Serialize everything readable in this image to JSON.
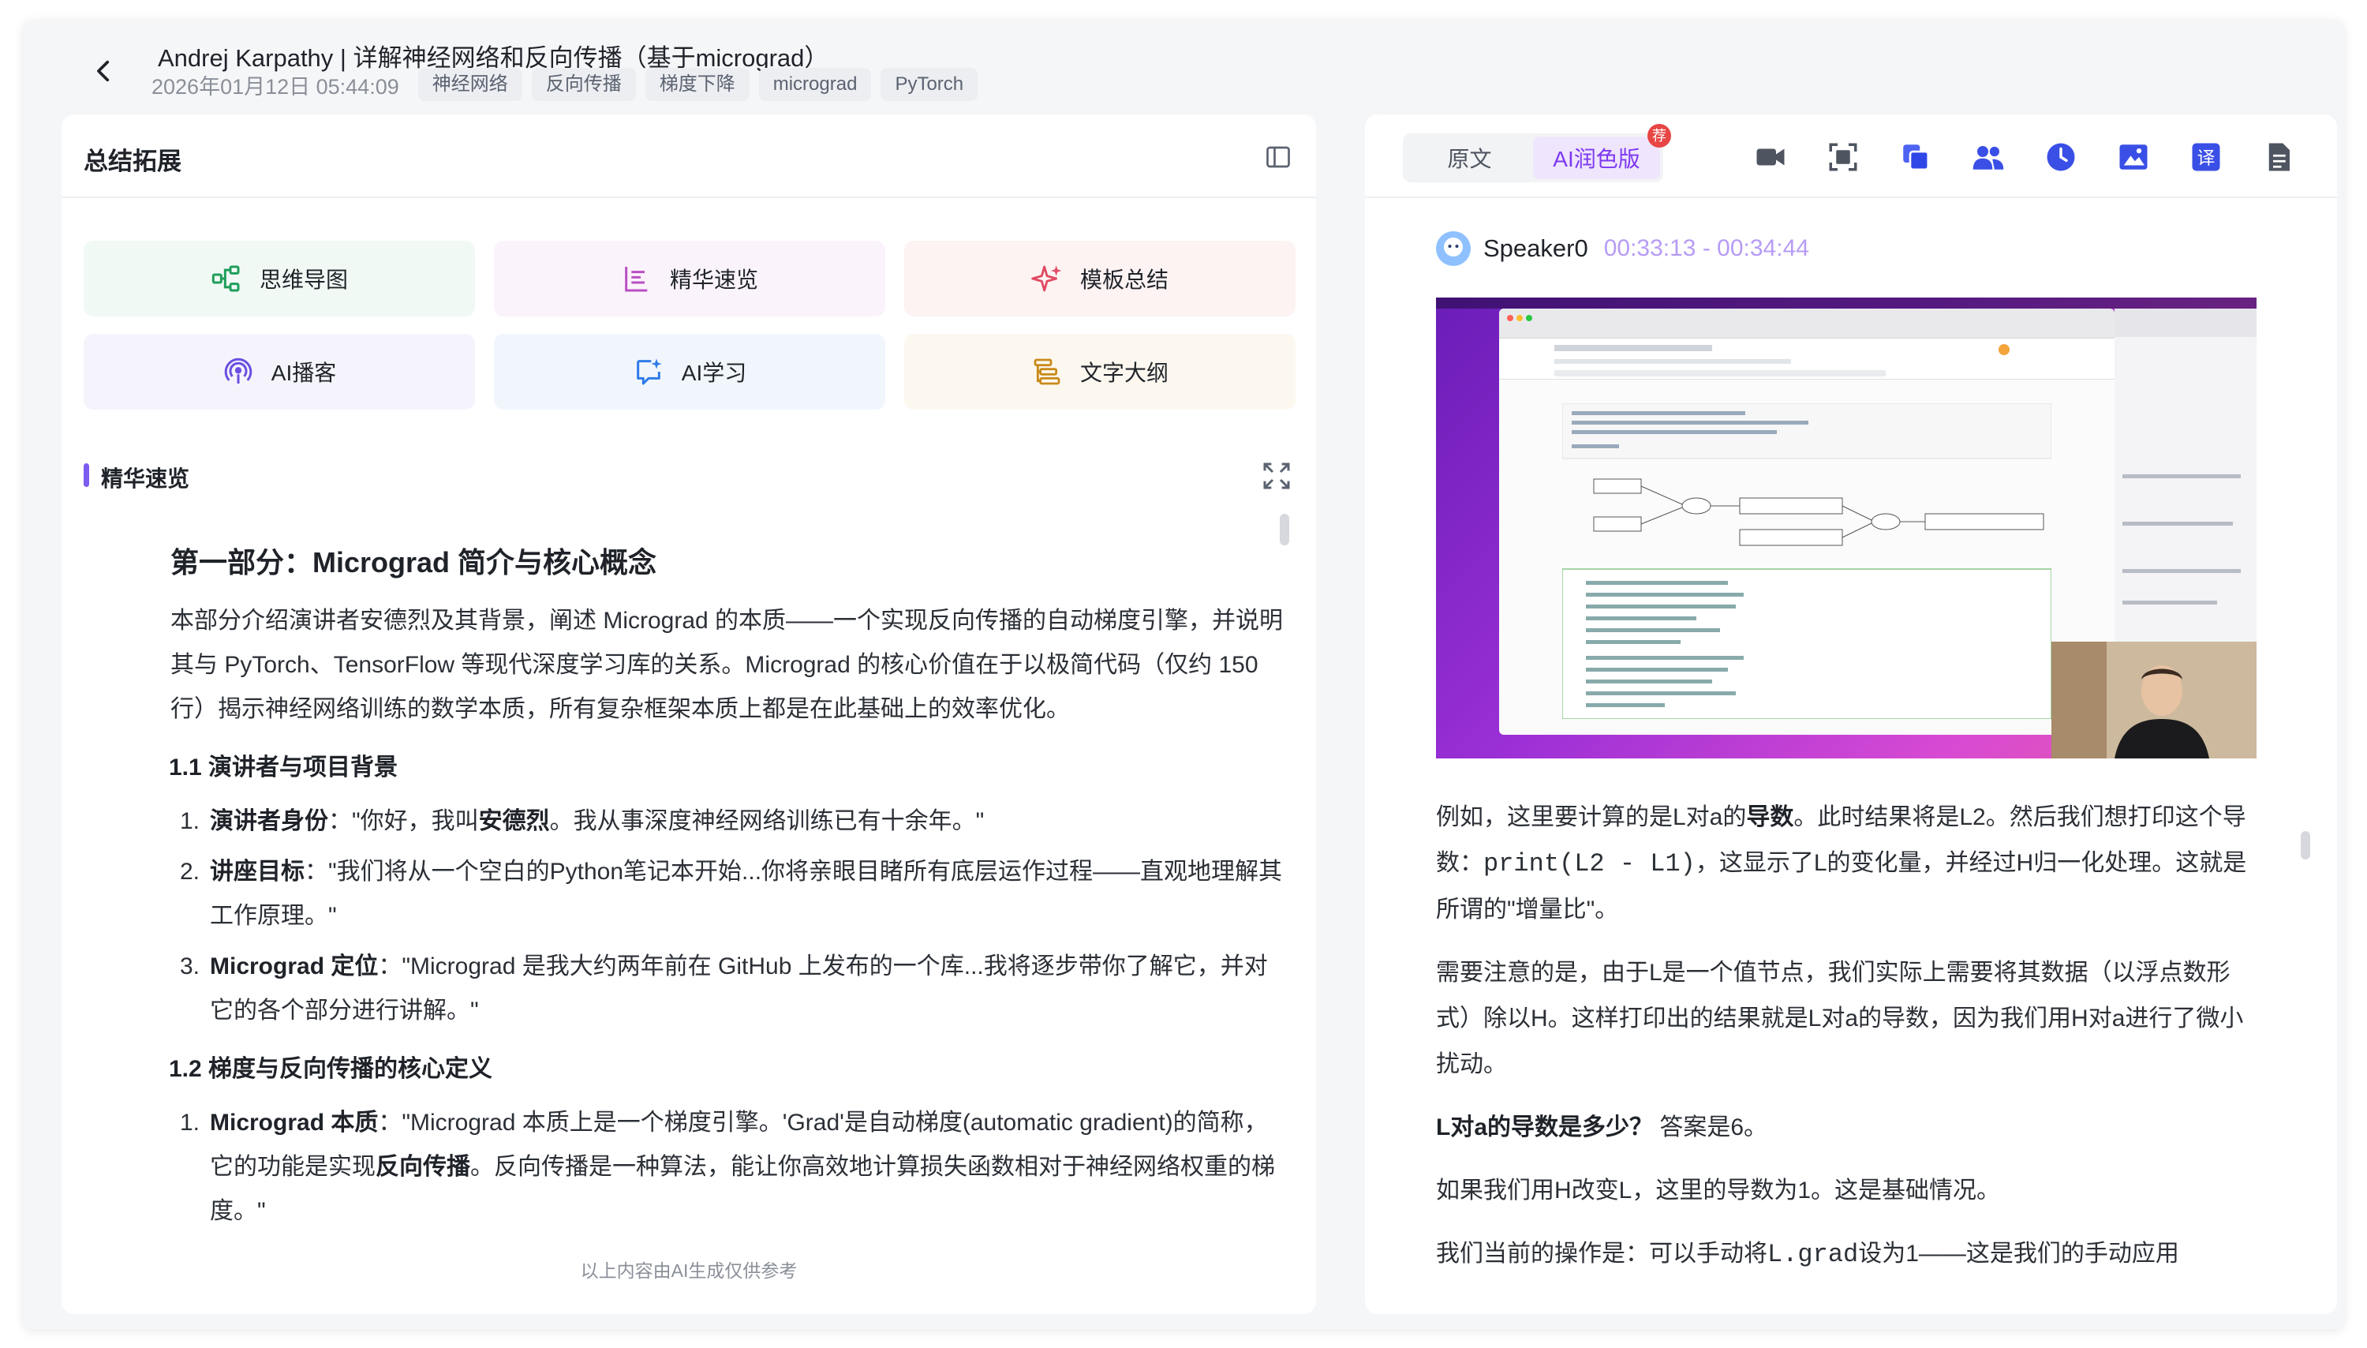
{
  "header": {
    "title": "Andrej Karpathy | 详解神经网络和反向传播（基于micrograd）",
    "date": "2026年01月12日 05:44:09",
    "tags": [
      "神经网络",
      "反向传播",
      "梯度下降",
      "micrograd",
      "PyTorch"
    ]
  },
  "left_panel": {
    "title": "总结拓展",
    "tools": [
      {
        "label": "思维导图",
        "icon": "mindmap-icon",
        "color": "#1e9e5a"
      },
      {
        "label": "精华速览",
        "icon": "list-icon",
        "color": "#b84fc4"
      },
      {
        "label": "模板总结",
        "icon": "sparkle-icon",
        "color": "#e04a62"
      },
      {
        "label": "AI播客",
        "icon": "podcast-icon",
        "color": "#6b4fe0"
      },
      {
        "label": "AI学习",
        "icon": "ai-learn-icon",
        "color": "#2f7be8"
      },
      {
        "label": "文字大纲",
        "icon": "outline-icon",
        "color": "#c98a1c"
      }
    ],
    "section_label": "精华速览",
    "article": {
      "heading": "第一部分：Micrograd 简介与核心概念",
      "intro": "本部分介绍演讲者安德烈及其背景，阐述 Micrograd 的本质——一个实现反向传播的自动梯度引擎，并说明其与 PyTorch、TensorFlow 等现代深度学习库的关系。Micrograd 的核心价值在于以极简代码（仅约 150 行）揭示神经网络训练的数学本质，所有复杂框架本质上都是在此基础上的效率优化。",
      "sub1": "1.1 演讲者与项目背景",
      "list1": [
        {
          "num": "1.",
          "bold": "演讲者身份",
          "pre": "：\"你好，我叫",
          "bold2": "安德烈",
          "post": "。我从事深度神经网络训练已有十余年。\""
        },
        {
          "num": "2.",
          "bold": "讲座目标",
          "pre": "：\"我们将从一个空白的Python笔记本开始...你将亲眼目睹所有底层运作过程——直观地理解其工作原理。\"",
          "bold2": "",
          "post": ""
        },
        {
          "num": "3.",
          "bold": "Micrograd 定位",
          "pre": "：\"Micrograd 是我大约两年前在 GitHub 上发布的一个库...我将逐步带你了解它，并对它的各个部分进行讲解。\"",
          "bold2": "",
          "post": ""
        }
      ],
      "sub2": "1.2 梯度与反向传播的核心定义",
      "list2": [
        {
          "num": "1.",
          "bold": "Micrograd 本质",
          "pre": "：\"Micrograd 本质上是一个梯度引擎。'Grad'是自动梯度(automatic gradient)的简称，它的功能是实现",
          "bold2": "反向传播",
          "post": "。反向传播是一种算法，能让你高效地计算损失函数相对于神经网络权重的梯度。\""
        }
      ]
    },
    "ai_note": "以上内容由AI生成仅供参考"
  },
  "right_panel": {
    "tabs": [
      "原文",
      "AI润色版"
    ],
    "badge": "荐",
    "toolbar_icons": [
      "video-icon",
      "screenshot-icon",
      "copy-icon",
      "speakers-icon",
      "clock-icon",
      "image-icon",
      "translate-icon",
      "document-icon"
    ],
    "speaker": {
      "name": "Speaker0",
      "time": "00:33:13 - 00:34:44"
    },
    "transcript": {
      "p1_pre": "例如，这里要计算的是L对a的",
      "p1_bold": "导数",
      "p1_mid": "。此时结果将是L2。然后我们想打印这个导数：",
      "p1_code": "print(L2 - L1)",
      "p1_post": "，这显示了L的变化量，并经过H归一化处理。这就是所谓的\"增量比\"。",
      "p2": "需要注意的是，由于L是一个值节点，我们实际上需要将其数据（以浮点数形式）除以H。这样打印出的结果就是L对a的导数，因为我们用H对a进行了微小扰动。",
      "p3_bold": "L对a的导数是多少？",
      "p3_post": " 答案是6。",
      "p4": "如果我们用H改变L，这里的导数为1。这是基础情况。",
      "p5_pre": "我们当前的操作是：可以手动将",
      "p5_code": "L.grad",
      "p5_post": "设为1——这是我们的手动应用"
    }
  }
}
